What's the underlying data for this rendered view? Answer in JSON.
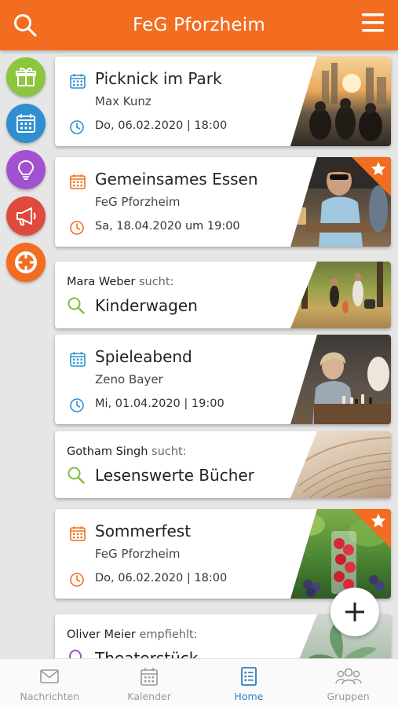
{
  "app": {
    "title": "FeG Pforzheim"
  },
  "colors": {
    "brand": "#f26d1f",
    "active_tab": "#2a7fc4",
    "search_green": "#7cc03a"
  },
  "side_actions": [
    {
      "name": "gift",
      "color": "#8cc63f"
    },
    {
      "name": "calendar",
      "color": "#2f8fd1"
    },
    {
      "name": "idea",
      "color": "#a351d1"
    },
    {
      "name": "announce",
      "color": "#e04a3c"
    },
    {
      "name": "help",
      "color": "#f26d1f"
    }
  ],
  "feed": {
    "events": [
      {
        "title": "Picknick im Park",
        "host": "Max Kunz",
        "date": "Do, 06.02.2020 | 18:00",
        "icon_color": "#2f8fd1",
        "featured": false
      },
      {
        "title": "Gemeinsames Essen",
        "host": "FeG Pforzheim",
        "date": "Sa, 18.04.2020 um 19:00",
        "icon_color": "#f26d1f",
        "featured": true
      },
      {
        "title": "Spieleabend",
        "host": "Zeno Bayer",
        "date": "Mi, 01.04.2020 | 19:00",
        "icon_color": "#2f8fd1",
        "featured": false
      },
      {
        "title": "Sommerfest",
        "host": "FeG Pforzheim",
        "date": "Do, 06.02.2020 | 18:00",
        "icon_color": "#f26d1f",
        "featured": true
      }
    ],
    "searches": [
      {
        "person": "Mara Weber",
        "verb": "sucht:",
        "query": "Kinderwagen"
      },
      {
        "person": "Gotham Singh",
        "verb": "sucht:",
        "query": "Lesenswerte Bücher"
      }
    ],
    "recommendation": {
      "person": "Oliver Meier",
      "verb": "empfiehlt:",
      "query": "Theaterstück"
    }
  },
  "bottom_nav": {
    "messages": "Nachrichten",
    "calendar": "Kalender",
    "home": "Home",
    "groups": "Gruppen"
  }
}
